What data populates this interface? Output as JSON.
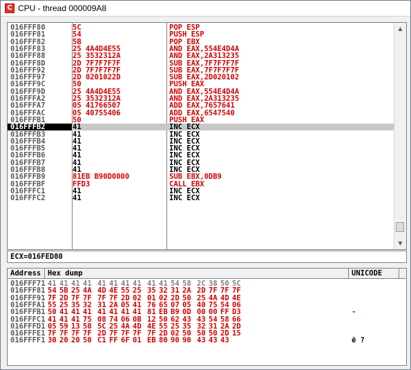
{
  "window": {
    "title": "CPU - thread 000009A8",
    "icon_letter": "C"
  },
  "disasm": {
    "rows": [
      {
        "addr": "016FFF80",
        "hex": "5C",
        "asm": "POP ESP"
      },
      {
        "addr": "016FFF81",
        "hex": "54",
        "asm": "PUSH ESP"
      },
      {
        "addr": "016FFF82",
        "hex": "5B",
        "asm": "POP EBX"
      },
      {
        "addr": "016FFF83",
        "hex": "25 4A4D4E55",
        "asm": "AND EAX,554E4D4A"
      },
      {
        "addr": "016FFF88",
        "hex": "25 3532312A",
        "asm": "AND EAX,2A313235"
      },
      {
        "addr": "016FFF8D",
        "hex": "2D 7F7F7F7F",
        "asm": "SUB EAX,7F7F7F7F"
      },
      {
        "addr": "016FFF92",
        "hex": "2D 7F7F7F7F",
        "asm": "SUB EAX,7F7F7F7F"
      },
      {
        "addr": "016FFF97",
        "hex": "2D 0201022D",
        "asm": "SUB EAX,2D020102"
      },
      {
        "addr": "016FFF9C",
        "hex": "50",
        "asm": "PUSH EAX"
      },
      {
        "addr": "016FFF9D",
        "hex": "25 4A4D4E55",
        "asm": "AND EAX,554E4D4A"
      },
      {
        "addr": "016FFFA2",
        "hex": "25 3532312A",
        "asm": "AND EAX,2A313235"
      },
      {
        "addr": "016FFFA7",
        "hex": "05 41766507",
        "asm": "ADD EAX,7657641"
      },
      {
        "addr": "016FFFAC",
        "hex": "05 40755406",
        "asm": "ADD EAX,6547540"
      },
      {
        "addr": "016FFFB1",
        "hex": "50",
        "asm": "PUSH EAX"
      },
      {
        "addr": "016FFFB2",
        "hex": "41",
        "asm": "INC ECX"
      },
      {
        "addr": "016FFFB3",
        "hex": "41",
        "asm": "INC ECX"
      },
      {
        "addr": "016FFFB4",
        "hex": "41",
        "asm": "INC ECX"
      },
      {
        "addr": "016FFFB5",
        "hex": "41",
        "asm": "INC ECX"
      },
      {
        "addr": "016FFFB6",
        "hex": "41",
        "asm": "INC ECX"
      },
      {
        "addr": "016FFFB7",
        "hex": "41",
        "asm": "INC ECX"
      },
      {
        "addr": "016FFFB8",
        "hex": "41",
        "asm": "INC ECX"
      },
      {
        "addr": "016FFFB9",
        "hex": "81EB B90D0000",
        "asm": "SUB EBX,0DB9"
      },
      {
        "addr": "016FFFBF",
        "hex": "FFD3",
        "asm": "CALL EBX"
      },
      {
        "addr": "016FFFC1",
        "hex": "41",
        "asm": "INC ECX"
      },
      {
        "addr": "016FFFC2",
        "hex": "41",
        "asm": "INC ECX"
      }
    ]
  },
  "info": {
    "text": "ECX=016FED80"
  },
  "dump": {
    "headers": {
      "address": "Address",
      "hex": "Hex dump",
      "unicode": "UNICODE"
    },
    "rows": [
      {
        "addr": "016FFF71",
        "bytes": [
          "41",
          "41",
          "41",
          "41",
          "41",
          "41",
          "41",
          "41",
          "41",
          "41",
          "54",
          "58",
          "2C",
          "38",
          "50",
          "5C"
        ],
        "uni": ""
      },
      {
        "addr": "016FFF81",
        "bytes": [
          "54",
          "5B",
          "25",
          "4A",
          "4D",
          "4E",
          "55",
          "25",
          "35",
          "32",
          "31",
          "2A",
          "2D",
          "7F",
          "7F",
          "7F"
        ],
        "uni": ""
      },
      {
        "addr": "016FFF91",
        "bytes": [
          "7F",
          "2D",
          "7F",
          "7F",
          "7F",
          "7F",
          "2D",
          "02",
          "01",
          "02",
          "2D",
          "50",
          "25",
          "4A",
          "4D",
          "4E"
        ],
        "uni": ""
      },
      {
        "addr": "016FFFA1",
        "bytes": [
          "55",
          "25",
          "35",
          "32",
          "31",
          "2A",
          "05",
          "41",
          "76",
          "65",
          "07",
          "05",
          "40",
          "75",
          "54",
          "06"
        ],
        "uni": ""
      },
      {
        "addr": "016FFFB1",
        "bytes": [
          "50",
          "41",
          "41",
          "41",
          "41",
          "41",
          "41",
          "41",
          "81",
          "EB",
          "B9",
          "0D",
          "00",
          "00",
          "FF",
          "D3"
        ],
        "uni": "-"
      },
      {
        "addr": "016FFFC1",
        "bytes": [
          "41",
          "41",
          "41",
          "75",
          "08",
          "74",
          "06",
          "0B",
          "12",
          "50",
          "62",
          "43",
          "43",
          "54",
          "58",
          "66"
        ],
        "uni": ""
      },
      {
        "addr": "016FFFD1",
        "bytes": [
          "05",
          "59",
          "13",
          "50",
          "5C",
          "25",
          "4A",
          "4D",
          "4E",
          "55",
          "25",
          "35",
          "32",
          "31",
          "2A",
          "2D"
        ],
        "uni": ""
      },
      {
        "addr": "016FFFE1",
        "bytes": [
          "7F",
          "7F",
          "7F",
          "7F",
          "2D",
          "7F",
          "7F",
          "7F",
          "7F",
          "2D",
          "02",
          "50",
          "50",
          "50",
          "2D",
          "15"
        ],
        "uni": ""
      },
      {
        "addr": "016FFFF1",
        "bytes": [
          "30",
          "20",
          "20",
          "50",
          "C1",
          "FF",
          "6F",
          "01",
          "EB",
          "80",
          "90",
          "90",
          "43",
          "43",
          "43",
          ""
        ],
        "uni": "ë      ?"
      }
    ]
  }
}
